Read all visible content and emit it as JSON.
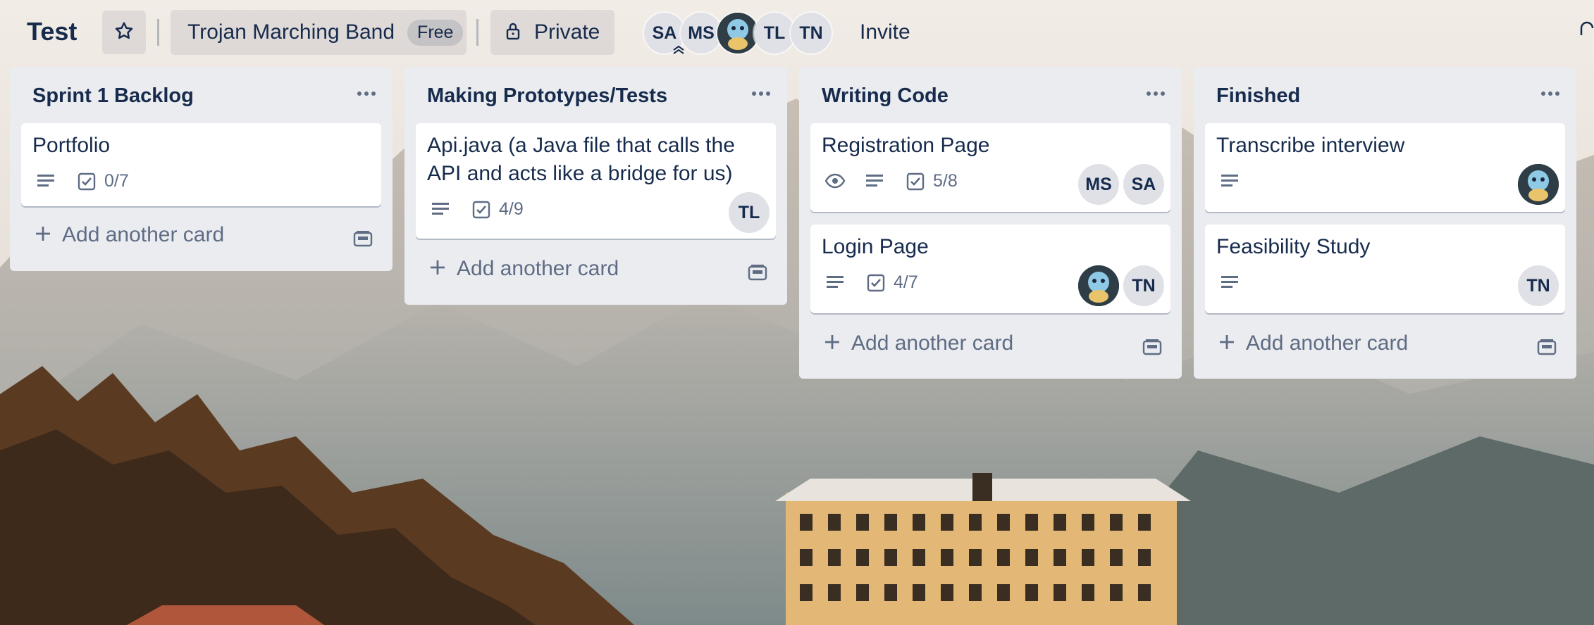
{
  "board": {
    "title": "Test",
    "team_name": "Trojan Marching Band",
    "plan_badge": "Free",
    "visibility": "Private",
    "invite_label": "Invite",
    "members": [
      "SA",
      "MS",
      "avatar",
      "TL",
      "TN"
    ]
  },
  "icons": {
    "star": "star-icon",
    "lock": "lock-icon",
    "more": "ellipsis-icon",
    "description": "description-icon",
    "checklist": "checklist-icon",
    "watch": "eye-icon",
    "add": "plus-icon",
    "template": "card-template-icon"
  },
  "colors": {
    "list_bg": "#ebecf0",
    "card_bg": "#ffffff",
    "text": "#172b4d",
    "muted": "#5e6c84",
    "avatar_bg": "#dfe1e6"
  },
  "lists": [
    {
      "title": "Sprint 1 Backlog",
      "add_label": "Add another card",
      "cards": [
        {
          "title": "Portfolio",
          "checklist": "0/7",
          "members": []
        }
      ]
    },
    {
      "title": "Making Prototypes/Tests",
      "add_label": "Add another card",
      "cards": [
        {
          "title": "Api.java (a Java file that calls the API and acts like a bridge for us)",
          "checklist": "4/9",
          "members": [
            "TL"
          ]
        }
      ]
    },
    {
      "title": "Writing Code",
      "add_label": "Add another card",
      "cards": [
        {
          "title": "Registration Page",
          "checklist": "5/8",
          "watched": true,
          "members": [
            "MS",
            "SA"
          ]
        },
        {
          "title": "Login Page",
          "checklist": "4/7",
          "members": [
            "avatar",
            "TN"
          ]
        }
      ]
    },
    {
      "title": "Finished",
      "add_label": "Add another card",
      "cards": [
        {
          "title": "Transcribe interview",
          "members": [
            "avatar"
          ]
        },
        {
          "title": "Feasibility Study",
          "members": [
            "TN"
          ]
        }
      ]
    }
  ]
}
